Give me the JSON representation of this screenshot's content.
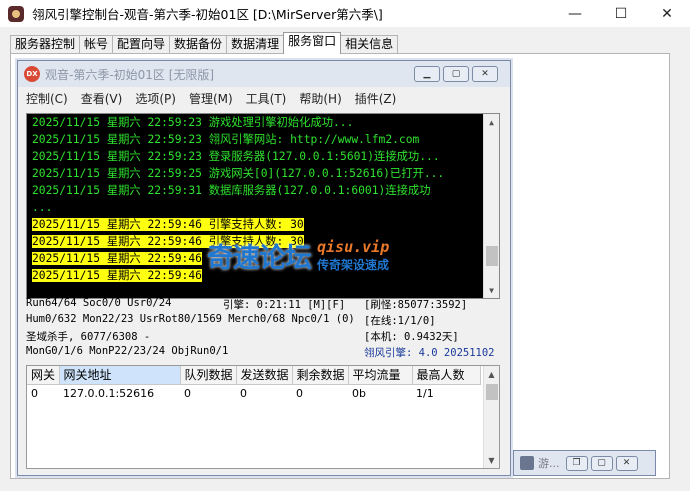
{
  "window": {
    "title": "翎风引擎控制台-观音-第六季-初始01区 [D:\\MirServer第六季\\]",
    "minimize": "—",
    "maximize": "☐",
    "close": "✕"
  },
  "tabs": [
    "服务器控制",
    "帐号",
    "配置向导",
    "数据备份",
    "数据清理",
    "服务窗口",
    "相关信息"
  ],
  "active_tab_index": 5,
  "child_window": {
    "title": "观音-第六季-初始01区 [无限版]",
    "icon_text": "DX",
    "menus": [
      "控制(C)",
      "查看(V)",
      "选项(P)",
      "管理(M)",
      "工具(T)",
      "帮助(H)",
      "插件(Z)"
    ]
  },
  "console": {
    "lines": [
      {
        "text": "2025/11/15 星期六 22:59:23 游戏处理引擎初始化成功...",
        "highlight": false
      },
      {
        "text": "2025/11/15 星期六 22:59:23 翎风引擎网站: http://www.lfm2.com",
        "highlight": false
      },
      {
        "text": "2025/11/15 星期六 22:59:23 登录服务器(127.0.0.1:5601)连接成功...",
        "highlight": false
      },
      {
        "text": "2025/11/15 星期六 22:59:25 游戏网关[0](127.0.0.1:52616)已打开...",
        "highlight": false
      },
      {
        "text": "2025/11/15 星期六 22:59:31 数据库服务器(127.0.0.1:6001)连接成功",
        "highlight": false
      },
      {
        "text": "...",
        "highlight": false
      },
      {
        "text": "2025/11/15 星期六 22:59:46 引擎支持人数: 30",
        "highlight": true
      },
      {
        "text": "2025/11/15 星期六 22:59:46 引擎支持人数: 30",
        "highlight": true
      },
      {
        "text": "2025/11/15 星期六 22:59:46",
        "highlight": true
      },
      {
        "text": "2025/11/15 星期六 22:59:46",
        "highlight": true
      }
    ]
  },
  "watermark": {
    "brand": "奇速论坛",
    "site": "qisu.vip",
    "slogan": "传奇架设速成"
  },
  "status": {
    "run": "Run64/64 Soc0/0 Usr0/24",
    "engine_time": "引擎: 0:21:11 [M][F]",
    "refresh": "[刷怪:85077:3592]",
    "hum": "Hum0/632 Mon22/23 UsrRot80/1569 Merch0/68 Npc0/1 (0)",
    "online": "[在线:1/1/0]",
    "kill": "圣域杀手, 6077/6308 -",
    "local": "[本机: 0.9432天]",
    "mongo": "MonG0/1/6 MonP22/23/24 ObjRun0/1",
    "version": "翎风引擎: 4.0 20251102"
  },
  "gateway_table": {
    "columns": [
      "网关",
      "网关地址",
      "队列数据",
      "发送数据",
      "剩余数据",
      "平均流量",
      "最高人数"
    ],
    "rows": [
      [
        "0",
        "127.0.0.1:52616",
        "0",
        "0",
        "0",
        "0b",
        "1/1"
      ]
    ]
  },
  "minimized_window": {
    "title": "游..."
  }
}
